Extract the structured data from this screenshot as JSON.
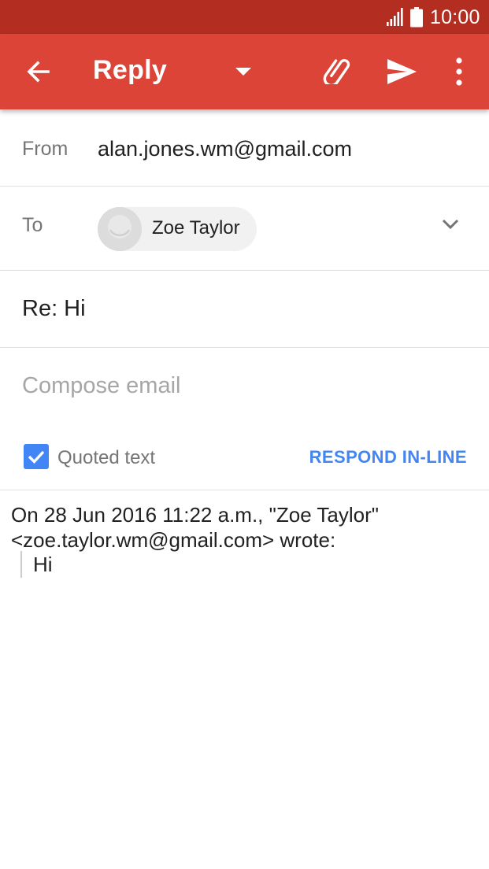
{
  "status_bar": {
    "time": "10:00",
    "icons": [
      "signal-icon",
      "battery-icon"
    ]
  },
  "app_bar": {
    "title": "Reply",
    "icons": [
      "back-arrow-icon",
      "dropdown-arrow-icon",
      "paperclip-icon",
      "send-icon",
      "more-vert-icon"
    ],
    "color": "#db4437",
    "status_color": "#b32d21"
  },
  "from": {
    "label": "From",
    "value": "alan.jones.wm@gmail.com"
  },
  "to": {
    "label": "To",
    "recipient": "Zoe Taylor",
    "icons": [
      "avatar-icon",
      "chevron-down-icon"
    ]
  },
  "subject": {
    "value": "Re: Hi"
  },
  "compose": {
    "placeholder": "Compose email"
  },
  "quoted": {
    "label": "Quoted text",
    "checked": true,
    "respond_inline": "RESPOND IN-LINE",
    "accent": "#4285f4"
  },
  "quote": {
    "header": "On 28 Jun 2016 11:22 a.m., \"Zoe Taylor\" <zoe.taylor.wm@gmail.com> wrote:",
    "body": "Hi"
  }
}
